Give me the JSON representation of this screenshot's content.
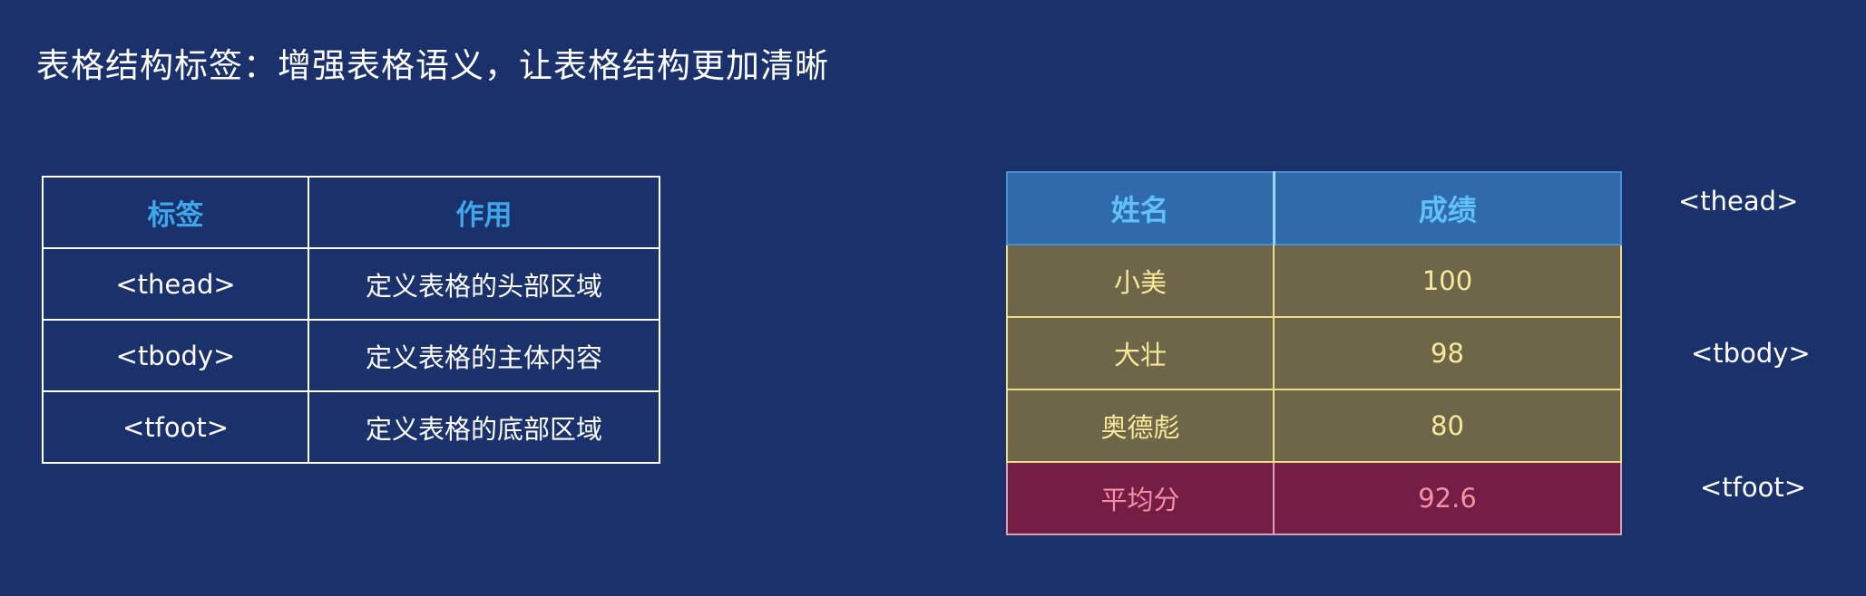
{
  "title": "表格结构标签：增强表格语义，让表格结构更加清晰",
  "reference_table": {
    "headers": [
      "标签",
      "作用"
    ],
    "rows": [
      {
        "tag": "<thead>",
        "desc": "定义表格的头部区域"
      },
      {
        "tag": "<tbody>",
        "desc": "定义表格的主体内容"
      },
      {
        "tag": "<tfoot>",
        "desc": "定义表格的底部区域"
      }
    ]
  },
  "example_table": {
    "headers": [
      "姓名",
      "成绩"
    ],
    "body": [
      {
        "name": "小美",
        "score": "100"
      },
      {
        "name": "大壮",
        "score": "98"
      },
      {
        "name": "奥德彪",
        "score": "80"
      }
    ],
    "footer": {
      "name": "平均分",
      "score": "92.6"
    }
  },
  "section_labels": {
    "thead": "<thead>",
    "tbody": "<tbody>",
    "tfoot": "<tfoot>"
  },
  "colors": {
    "background": "#1a316c",
    "header_text": "#3ea7ec",
    "thead_bg": "#2f6aaa",
    "tbody_bg": "#6e6649",
    "tbody_text": "#f8e99a",
    "tfoot_bg": "#741d45",
    "tfoot_text": "#f48fa6"
  }
}
